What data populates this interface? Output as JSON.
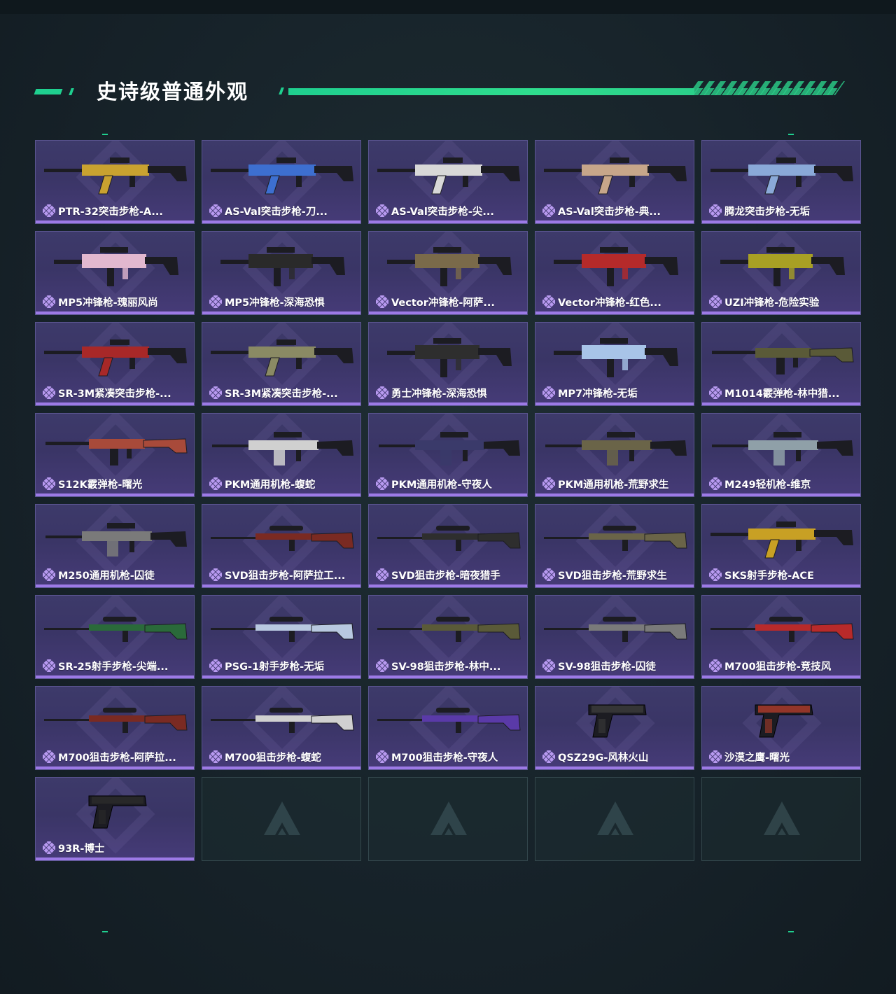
{
  "section": {
    "title": "史诗级普通外观"
  },
  "colors": {
    "accent": "#1fcf8f",
    "card_bg": "#3d3a6a",
    "rarity": "#9d7ae6"
  },
  "items": [
    {
      "label": "PTR-32突击步枪-A...",
      "color": "#c9a230",
      "kind": "rifle"
    },
    {
      "label": "AS-Val突击步枪-刀...",
      "color": "#3d6fd0",
      "kind": "rifle"
    },
    {
      "label": "AS-Val突击步枪-尖...",
      "color": "#d8d8d8",
      "kind": "rifle"
    },
    {
      "label": "AS-Val突击步枪-典...",
      "color": "#c7a68a",
      "kind": "rifle"
    },
    {
      "label": "腾龙突击步枪-无垢",
      "color": "#8aa9d8",
      "kind": "rifle"
    },
    {
      "label": "MP5冲锋枪-瑰丽风尚",
      "color": "#e2b8cf",
      "kind": "smg"
    },
    {
      "label": "MP5冲锋枪-深海恐惧",
      "color": "#2a2a2a",
      "kind": "smg"
    },
    {
      "label": "Vector冲锋枪-阿萨...",
      "color": "#7a6a4a",
      "kind": "smg"
    },
    {
      "label": "Vector冲锋枪-红色...",
      "color": "#b52a2a",
      "kind": "smg"
    },
    {
      "label": "UZI冲锋枪-危险实验",
      "color": "#a8a024",
      "kind": "smg"
    },
    {
      "label": "SR-3M紧凑突击步枪-...",
      "color": "#a82828",
      "kind": "rifle"
    },
    {
      "label": "SR-3M紧凑突击步枪-...",
      "color": "#8a8a64",
      "kind": "rifle"
    },
    {
      "label": "勇士冲锋枪-深海恐惧",
      "color": "#2e2e2e",
      "kind": "smg"
    },
    {
      "label": "MP7冲锋枪-无垢",
      "color": "#a8c4e8",
      "kind": "smg"
    },
    {
      "label": "M1014霰弹枪-林中猎...",
      "color": "#5a5a38",
      "kind": "shotgun"
    },
    {
      "label": "S12K霰弹枪-曙光",
      "color": "#a84a3a",
      "kind": "shotgun"
    },
    {
      "label": "PKM通用机枪-蝮蛇",
      "color": "#d0d0d0",
      "kind": "mg"
    },
    {
      "label": "PKM通用机枪-守夜人",
      "color": "#3a3a6a",
      "kind": "mg"
    },
    {
      "label": "PKM通用机枪-荒野求生",
      "color": "#6a6448",
      "kind": "mg"
    },
    {
      "label": "M249轻机枪-维京",
      "color": "#8fa0a8",
      "kind": "mg"
    },
    {
      "label": "M250通用机枪-囚徒",
      "color": "#7a7a7a",
      "kind": "mg"
    },
    {
      "label": "SVD狙击步枪-阿萨拉工...",
      "color": "#7a2a22",
      "kind": "sniper"
    },
    {
      "label": "SVD狙击步枪-暗夜猎手",
      "color": "#2e2e2e",
      "kind": "sniper"
    },
    {
      "label": "SVD狙击步枪-荒野求生",
      "color": "#6a6448",
      "kind": "sniper"
    },
    {
      "label": "SKS射手步枪-ACE",
      "color": "#c8a024",
      "kind": "rifle"
    },
    {
      "label": "SR-25射手步枪-尖端...",
      "color": "#2a6a3a",
      "kind": "sniper"
    },
    {
      "label": "PSG-1射手步枪-无垢",
      "color": "#b8c8e0",
      "kind": "sniper"
    },
    {
      "label": "SV-98狙击步枪-林中...",
      "color": "#5a5a38",
      "kind": "sniper"
    },
    {
      "label": "SV-98狙击步枪-囚徒",
      "color": "#7a7a7a",
      "kind": "sniper"
    },
    {
      "label": "M700狙击步枪-竞技风",
      "color": "#b82a2a",
      "kind": "sniper"
    },
    {
      "label": "M700狙击步枪-阿萨拉...",
      "color": "#7a2a22",
      "kind": "sniper"
    },
    {
      "label": "M700狙击步枪-蝮蛇",
      "color": "#d0d0d0",
      "kind": "sniper"
    },
    {
      "label": "M700狙击步枪-守夜人",
      "color": "#5a3aa8",
      "kind": "sniper"
    },
    {
      "label": "QSZ29G-风林火山",
      "color": "#3a3a3a",
      "kind": "pistol"
    },
    {
      "label": "沙漠之鹰-曙光",
      "color": "#a83a2a",
      "kind": "pistol"
    },
    {
      "label": "93R-博士",
      "color": "#2a2a2a",
      "kind": "pistol"
    }
  ],
  "empty_slots": 4
}
